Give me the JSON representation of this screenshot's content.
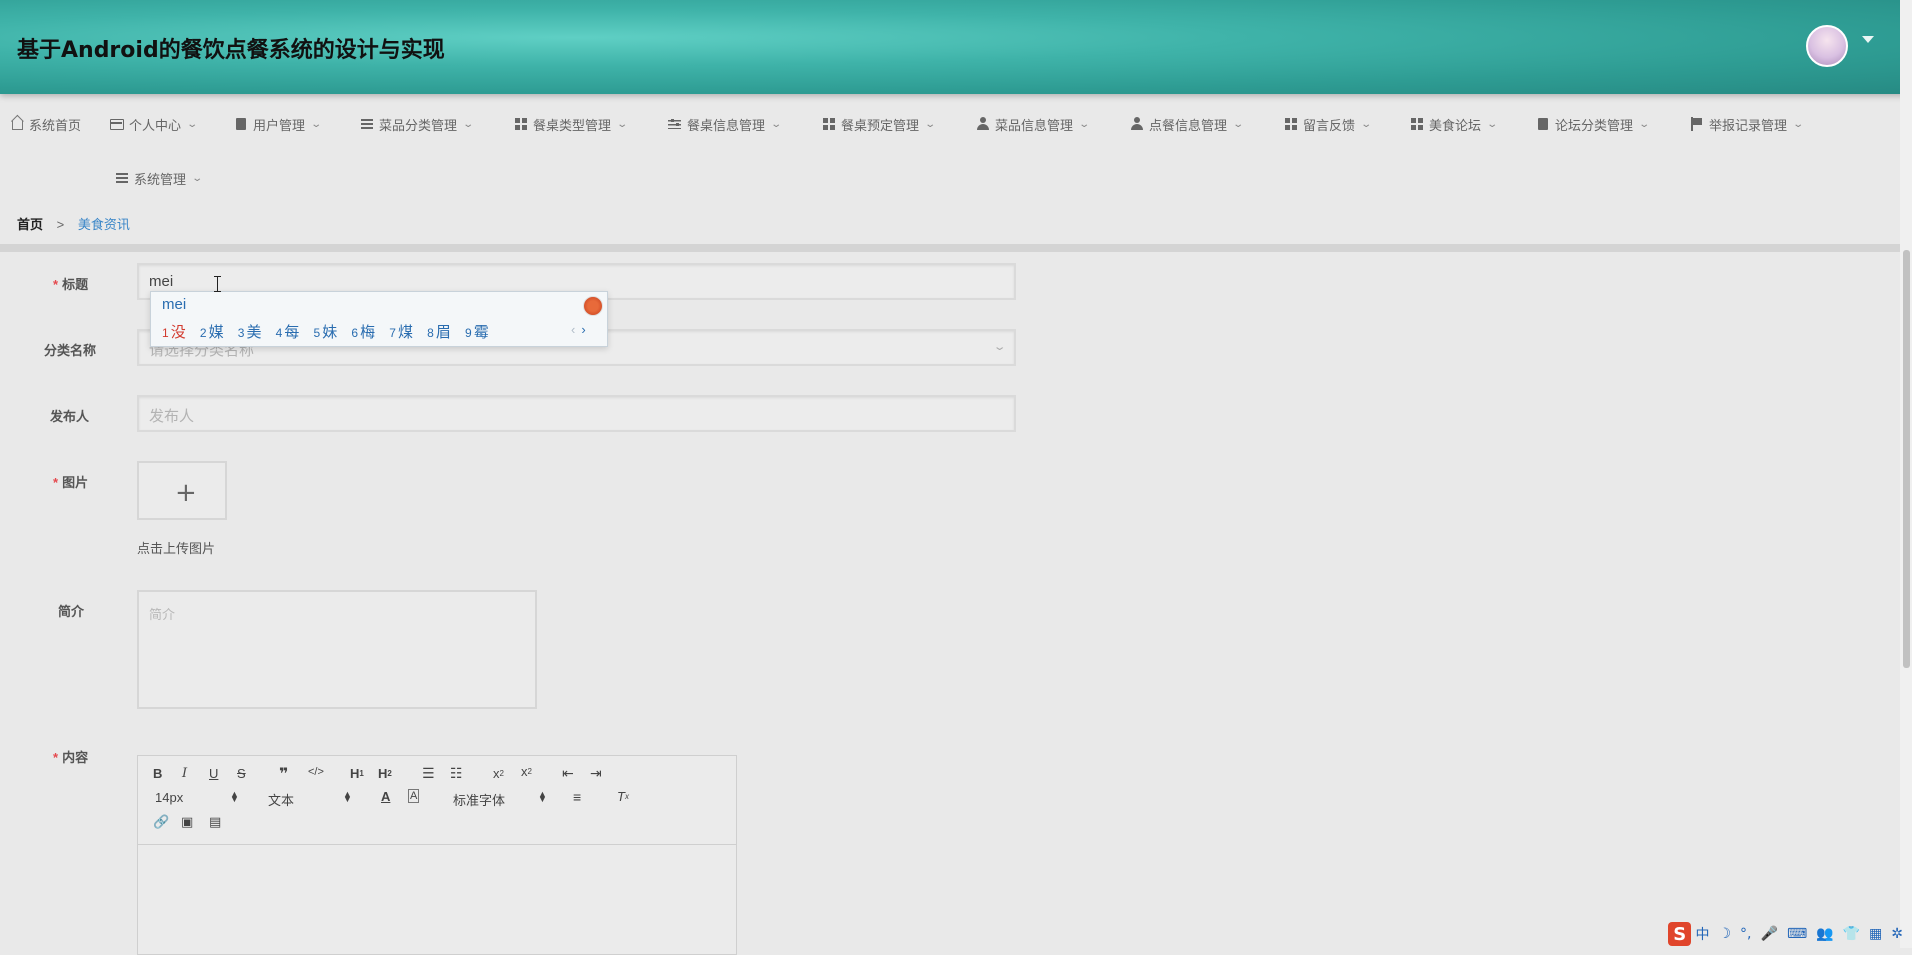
{
  "header": {
    "title": "基于Android的餐饮点餐系统的设计与实现"
  },
  "nav": {
    "items": [
      {
        "label": "系统首页",
        "icon": "home-icon"
      },
      {
        "label": "个人中心",
        "icon": "card-icon"
      },
      {
        "label": "用户管理",
        "icon": "clipboard-icon"
      },
      {
        "label": "菜品分类管理",
        "icon": "list-icon"
      },
      {
        "label": "餐桌类型管理",
        "icon": "grid-icon"
      },
      {
        "label": "餐桌信息管理",
        "icon": "sliders-icon"
      },
      {
        "label": "餐桌预定管理",
        "icon": "grid-icon"
      },
      {
        "label": "菜品信息管理",
        "icon": "user-icon"
      },
      {
        "label": "点餐信息管理",
        "icon": "user-icon"
      },
      {
        "label": "留言反馈",
        "icon": "grid-icon"
      },
      {
        "label": "美食论坛",
        "icon": "grid-icon"
      },
      {
        "label": "论坛分类管理",
        "icon": "clipboard-icon"
      },
      {
        "label": "举报记录管理",
        "icon": "flag-icon"
      },
      {
        "label": "系统管理",
        "icon": "list-icon"
      }
    ]
  },
  "breadcrumb": {
    "home": "首页",
    "separator": ">",
    "current": "美食资讯"
  },
  "form": {
    "title_label": "标题",
    "title_value": "mei",
    "category_label": "分类名称",
    "category_placeholder": "请选择分类名称",
    "publisher_label": "发布人",
    "publisher_placeholder": "发布人",
    "image_label": "图片",
    "upload_plus": "+",
    "upload_text": "点击上传图片",
    "intro_label": "简介",
    "intro_placeholder": "简介",
    "content_label": "内容",
    "required_mark": "*"
  },
  "editor": {
    "font_size": "14px",
    "header_select": "文本",
    "font_family": "标准字体"
  },
  "ime": {
    "input": "mei",
    "candidates": [
      {
        "n": "1",
        "w": "没"
      },
      {
        "n": "2",
        "w": "媒"
      },
      {
        "n": "3",
        "w": "美"
      },
      {
        "n": "4",
        "w": "每"
      },
      {
        "n": "5",
        "w": "妹"
      },
      {
        "n": "6",
        "w": "梅"
      },
      {
        "n": "7",
        "w": "煤"
      },
      {
        "n": "8",
        "w": "眉"
      },
      {
        "n": "9",
        "w": "霉"
      }
    ],
    "prev": "‹",
    "next": "›"
  },
  "tray": {
    "logo": "S",
    "items": [
      "中",
      "☽",
      "°,",
      "🎤",
      "⌨",
      "👥",
      "👕",
      "▦",
      "✲"
    ]
  },
  "colors": {
    "accent": "#3a86c8",
    "required": "#e5484d",
    "header": "#3fb3a9"
  }
}
